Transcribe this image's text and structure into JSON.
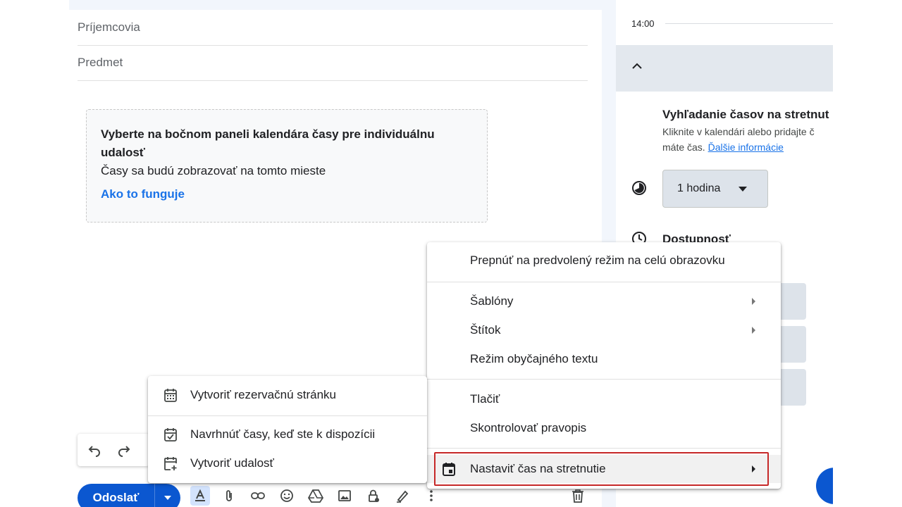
{
  "compose": {
    "recipients_placeholder": "Príjemcovia",
    "subject_placeholder": "Predmet",
    "hint": {
      "title": "Vyberte na bočnom paneli kalendára časy pre individuálnu udalosť",
      "subtitle": "Časy sa budú zobrazovať na tomto mieste",
      "link": "Ako to funguje"
    },
    "send_label": "Odoslať"
  },
  "calendar_panel": {
    "time_label": "14:00",
    "find_title": "Vyhľadanie časov na stretnut",
    "find_desc_line1": "Kliknite v kalendári alebo pridajte č",
    "find_desc_line2": "máte čas.",
    "find_link": "Ďalšie informácie",
    "duration": "1 hodina",
    "availability_label": "Dostupnosť"
  },
  "more_options_menu": {
    "items": [
      {
        "label": "Prepnúť na predvolený režim na celú obrazovku"
      },
      {
        "label": "Šablóny"
      },
      {
        "label": "Štítok"
      },
      {
        "label": "Režim obyčajného textu"
      },
      {
        "label": "Tlačiť"
      },
      {
        "label": "Skontrolovať pravopis"
      },
      {
        "label": "Nastaviť čas na stretnutie"
      }
    ]
  },
  "meeting_submenu": {
    "items": [
      {
        "label": "Vytvoriť rezervačnú stránku"
      },
      {
        "label": "Navrhnúť časy, keď ste k dispozícii"
      },
      {
        "label": "Vytvoriť udalosť"
      }
    ]
  },
  "colors": {
    "send_button": "#0b57d0",
    "link": "#1a73e8",
    "highlight_border": "#c62828"
  }
}
